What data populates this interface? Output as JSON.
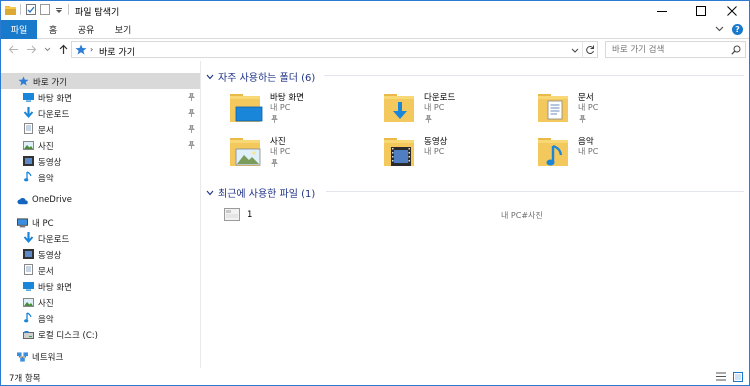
{
  "window": {
    "title": "파일 탐색기",
    "accent": "#1979ca"
  },
  "ribbon": {
    "tabs": [
      "파일",
      "홈",
      "공유",
      "보기"
    ],
    "help": "?"
  },
  "address": {
    "path": "바로 가기",
    "search_placeholder": "바로 가기 검색"
  },
  "nav": {
    "quick_access": "바로 가기",
    "quick_items": [
      {
        "label": "바탕 화면",
        "icon": "desktop-icon",
        "pinned": true
      },
      {
        "label": "다운로드",
        "icon": "download-icon",
        "pinned": true
      },
      {
        "label": "문서",
        "icon": "documents-icon",
        "pinned": true
      },
      {
        "label": "사진",
        "icon": "pictures-icon",
        "pinned": true
      },
      {
        "label": "동영상",
        "icon": "videos-icon",
        "pinned": false
      },
      {
        "label": "음악",
        "icon": "music-icon",
        "pinned": false
      }
    ],
    "onedrive": "OneDrive",
    "this_pc": "내 PC",
    "pc_items": [
      {
        "label": "다운로드",
        "icon": "download-icon"
      },
      {
        "label": "동영상",
        "icon": "videos-icon"
      },
      {
        "label": "문서",
        "icon": "documents-icon"
      },
      {
        "label": "바탕 화면",
        "icon": "desktop-icon"
      },
      {
        "label": "사진",
        "icon": "pictures-icon"
      },
      {
        "label": "음악",
        "icon": "music-icon"
      },
      {
        "label": "로컬 디스크 (C:)",
        "icon": "drive-icon"
      }
    ],
    "network": "네트워크"
  },
  "content": {
    "frequent_header": "자주 사용하는 폴더 (6)",
    "folders": [
      {
        "name": "바탕 화면",
        "location": "내 PC",
        "pinned": true,
        "icon": "desktop-folder-icon"
      },
      {
        "name": "다운로드",
        "location": "내 PC",
        "pinned": true,
        "icon": "download-folder-icon"
      },
      {
        "name": "문서",
        "location": "내 PC",
        "pinned": true,
        "icon": "documents-folder-icon"
      },
      {
        "name": "사진",
        "location": "내 PC",
        "pinned": true,
        "icon": "pictures-folder-icon"
      },
      {
        "name": "동영상",
        "location": "내 PC",
        "pinned": false,
        "icon": "videos-folder-icon"
      },
      {
        "name": "음악",
        "location": "내 PC",
        "pinned": false,
        "icon": "music-folder-icon"
      }
    ],
    "recent_header": "최근에 사용한 파일 (1)",
    "recent_files": [
      {
        "name": "1",
        "path": "내 PC#사진"
      }
    ]
  },
  "status": {
    "item_count": "7개 항목"
  }
}
